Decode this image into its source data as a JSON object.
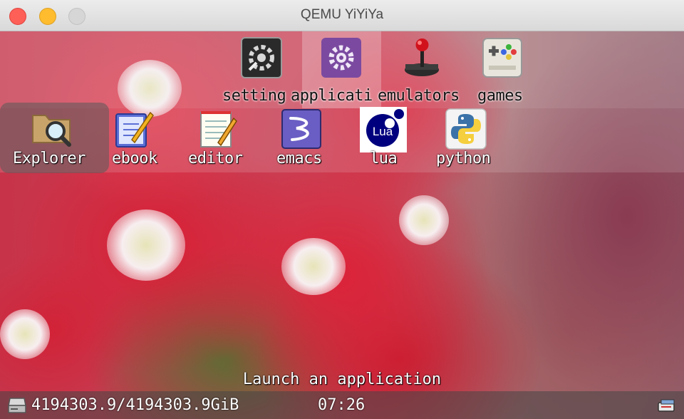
{
  "window": {
    "title": "QEMU YiYiYa"
  },
  "categories": [
    {
      "label": "setting",
      "icon": "settings-gear-icon"
    },
    {
      "label": "applicati",
      "icon": "applications-gear-icon"
    },
    {
      "label": "emulators",
      "icon": "joystick-icon"
    },
    {
      "label": "games",
      "icon": "gamepad-icon"
    }
  ],
  "apps": [
    {
      "label": "Explorer",
      "icon": "folder-search-icon"
    },
    {
      "label": "ebook",
      "icon": "ebook-pen-icon"
    },
    {
      "label": "editor",
      "icon": "notepad-icon"
    },
    {
      "label": "emacs",
      "icon": "emacs-icon"
    },
    {
      "label": "lua",
      "icon": "lua-logo-icon",
      "logo_text": "Lua"
    },
    {
      "label": "python",
      "icon": "python-logo-icon"
    }
  ],
  "status": {
    "message": "Launch an application",
    "disk": "4194303.9/4194303.9GiB",
    "time": "07:26"
  },
  "colors": {
    "close": "#fe5f57",
    "minimize": "#febc2e",
    "maximize": "#d6d6d6",
    "lua_blue": "#00007f"
  }
}
